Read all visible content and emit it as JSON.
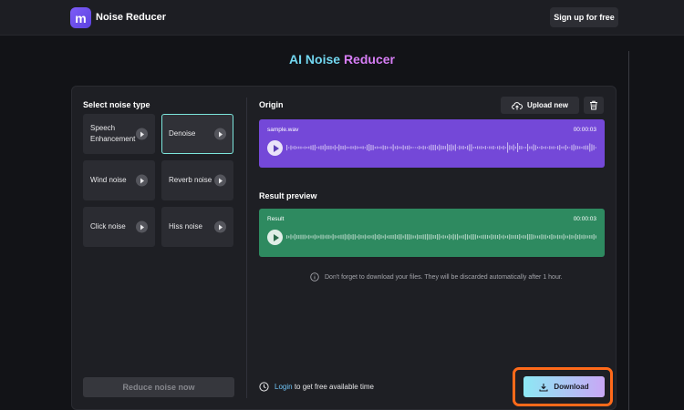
{
  "header": {
    "brand": "Noise Reducer",
    "logo_letter": "m",
    "signup_label": "Sign up for free"
  },
  "title": {
    "part1": "AI Noise",
    "part2": "Reducer"
  },
  "noise_types": {
    "heading": "Select noise type",
    "items": [
      {
        "label": "Speech Enhancement",
        "active": false
      },
      {
        "label": "Denoise",
        "active": true
      },
      {
        "label": "Wind noise",
        "active": false
      },
      {
        "label": "Reverb noise",
        "active": false
      },
      {
        "label": "Click noise",
        "active": false
      },
      {
        "label": "Hiss noise",
        "active": false
      }
    ],
    "reduce_label": "Reduce noise now"
  },
  "origin": {
    "heading": "Origin",
    "upload_label": "Upload new",
    "file_name": "sample.wav",
    "duration": "00:00:03"
  },
  "result": {
    "heading": "Result preview",
    "name": "Result",
    "duration": "00:00:03"
  },
  "notice": "Don't forget to download your files. They will be discarded automatically after 1 hour.",
  "login": {
    "link": "Login",
    "suffix": "to get free available time"
  },
  "download_label": "Download",
  "colors": {
    "origin_wave": "#7448d8",
    "result_wave": "#2e8a60",
    "highlight": "#ff6a1a",
    "accent_cyan": "#72d7f0",
    "accent_pink": "#d77ef6"
  }
}
